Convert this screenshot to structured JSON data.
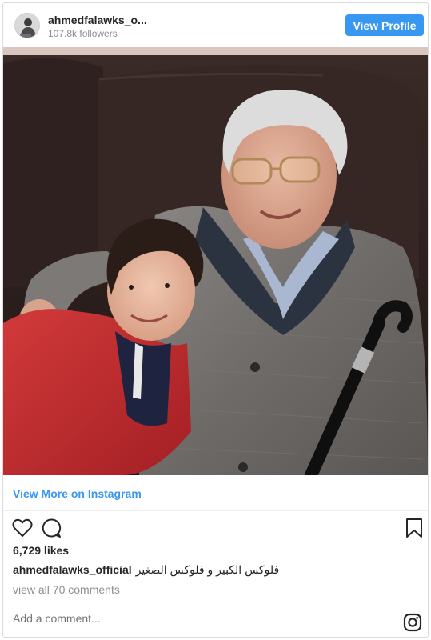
{
  "header": {
    "username": "ahmedfalawks_o...",
    "followers": "107.8k followers",
    "view_profile_label": "View Profile"
  },
  "photo": {
    "alt": "Photo of an elderly man with a cane and a young boy in a red jacket sitting on a dark brown sofa"
  },
  "view_more_label": "View More on Instagram",
  "actions": {
    "icons": [
      "heart-icon",
      "comment-icon",
      "bookmark-icon"
    ]
  },
  "likes": "6,729 likes",
  "caption": {
    "username": "ahmedfalawks_official",
    "text": "فلوكس الكبير و فلوكس الصغير"
  },
  "view_comments_label": "view all 70 comments",
  "comment": {
    "placeholder": "Add a comment..."
  },
  "footer": {
    "logo_icon": "instagram-icon"
  },
  "colors": {
    "accent": "#3897f0",
    "text": "#262626",
    "muted": "#8e8e8e",
    "border": "#dbdbdb"
  }
}
